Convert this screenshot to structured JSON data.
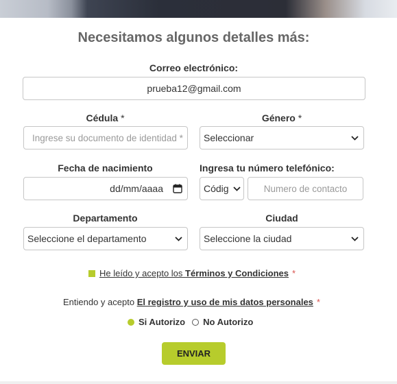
{
  "form": {
    "title": "Necesitamos algunos detalles más:",
    "email": {
      "label": "Correo electrónico:",
      "value": "prueba12@gmail.com"
    },
    "cedula": {
      "label": "Cédula",
      "required": "*",
      "placeholder": "Ingrese su documento de identidad *"
    },
    "genero": {
      "label": "Género",
      "required": "*",
      "selected": "Seleccionar"
    },
    "birthdate": {
      "label": "Fecha de nacimiento",
      "placeholder": "dd/mm/aaaa"
    },
    "phone": {
      "label": "Ingresa tu número telefónico:",
      "code_selected": "Códig",
      "placeholder": "Numero de contacto"
    },
    "departamento": {
      "label": "Departamento",
      "selected": "Seleccione el departamento"
    },
    "ciudad": {
      "label": "Ciudad",
      "selected": "Seleccione la ciudad"
    },
    "terms": {
      "prefix": "He leído y acepto los ",
      "link": "Términos y Condiciones",
      "required": "*"
    },
    "consent": {
      "prefix": "Entiendo y acepto ",
      "link": "El registro y uso de mis datos personales",
      "required": "*"
    },
    "authorize": {
      "yes": "Si Autorizo",
      "no": "No Autorizo",
      "selected": "yes"
    },
    "submit_label": "ENVIAR"
  },
  "colors": {
    "accent": "#b7cc2c",
    "required_star": "#d9534f"
  }
}
